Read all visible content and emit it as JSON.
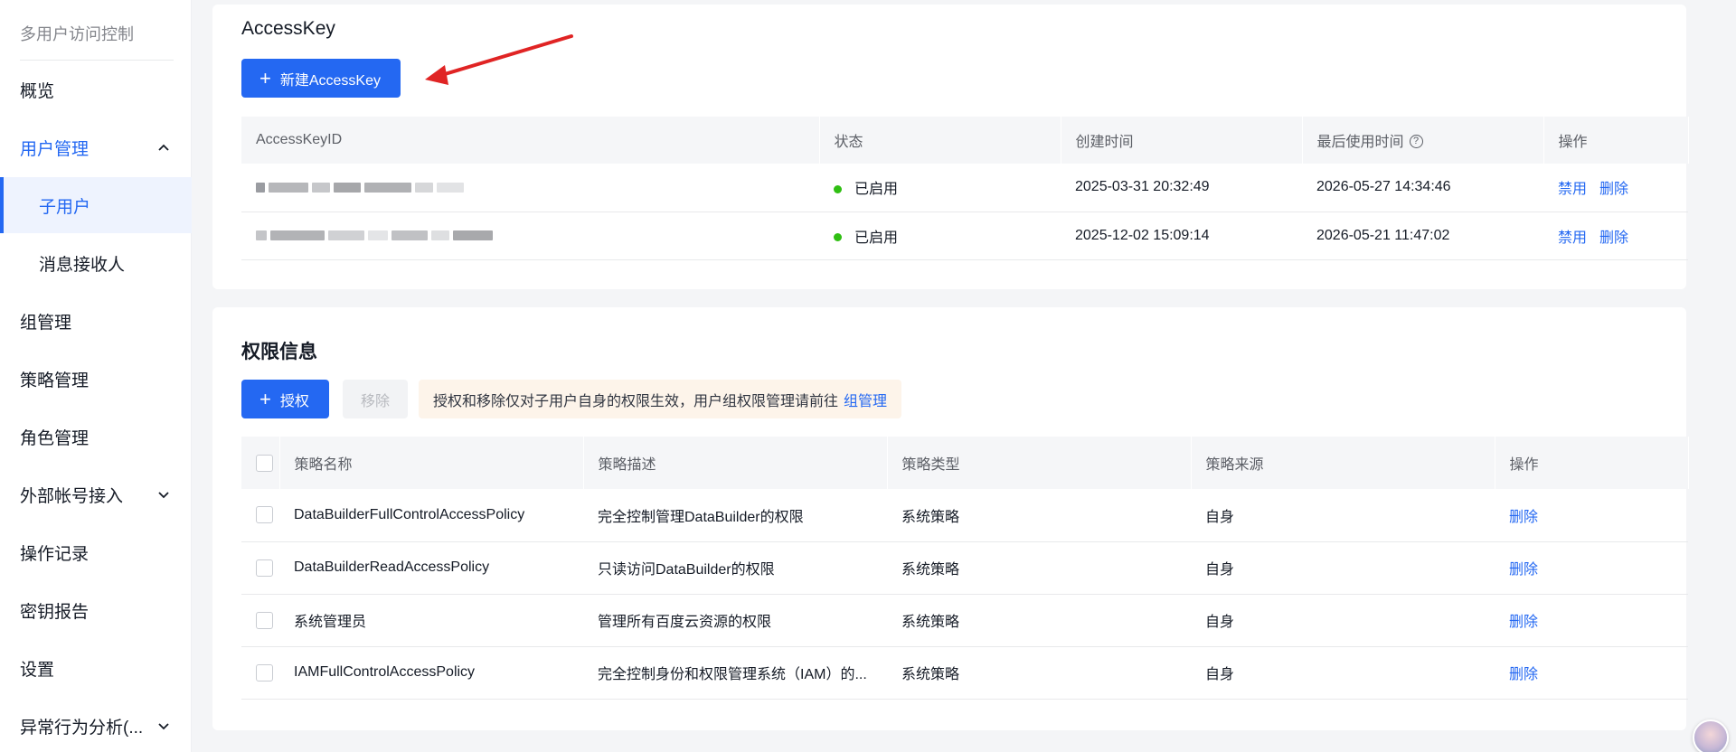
{
  "sidebar": {
    "title": "多用户访问控制",
    "items": [
      {
        "label": "概览"
      },
      {
        "label": "用户管理"
      },
      {
        "label": "子用户"
      },
      {
        "label": "消息接收人"
      },
      {
        "label": "组管理"
      },
      {
        "label": "策略管理"
      },
      {
        "label": "角色管理"
      },
      {
        "label": "外部帐号接入"
      },
      {
        "label": "操作记录"
      },
      {
        "label": "密钥报告"
      },
      {
        "label": "设置"
      },
      {
        "label": "异常行为分析(..."
      }
    ]
  },
  "accesskey": {
    "title": "AccessKey",
    "new_button": "新建AccessKey",
    "columns": [
      "AccessKeyID",
      "状态",
      "创建时间",
      "最后使用时间",
      "操作"
    ],
    "rows": [
      {
        "status": "已启用",
        "created": "2025-03-31 20:32:49",
        "last_used": "2026-05-27 14:34:46",
        "action_disable": "禁用",
        "action_delete": "删除"
      },
      {
        "status": "已启用",
        "created": "2025-12-02 15:09:14",
        "last_used": "2026-05-21 11:47:02",
        "action_disable": "禁用",
        "action_delete": "删除"
      }
    ]
  },
  "permissions": {
    "title": "权限信息",
    "grant_button": "授权",
    "remove_button": "移除",
    "notice_text": "授权和移除仅对子用户自身的权限生效，用户组权限管理请前往",
    "notice_link": "组管理",
    "columns": [
      "策略名称",
      "策略描述",
      "策略类型",
      "策略来源",
      "操作"
    ],
    "rows": [
      {
        "name": "DataBuilderFullControlAccessPolicy",
        "desc": "完全控制管理DataBuilder的权限",
        "type": "系统策略",
        "source": "自身",
        "action": "删除"
      },
      {
        "name": "DataBuilderReadAccessPolicy",
        "desc": "只读访问DataBuilder的权限",
        "type": "系统策略",
        "source": "自身",
        "action": "删除"
      },
      {
        "name": "系统管理员",
        "desc": "管理所有百度云资源的权限",
        "type": "系统策略",
        "source": "自身",
        "action": "删除"
      },
      {
        "name": "IAMFullControlAccessPolicy",
        "desc": "完全控制身份和权限管理系统（IAM）的...",
        "type": "系统策略",
        "source": "自身",
        "action": "删除"
      }
    ]
  },
  "colors": {
    "primary": "#2468f2",
    "status_enabled": "#30bf13",
    "annotation_arrow": "#e02424"
  }
}
